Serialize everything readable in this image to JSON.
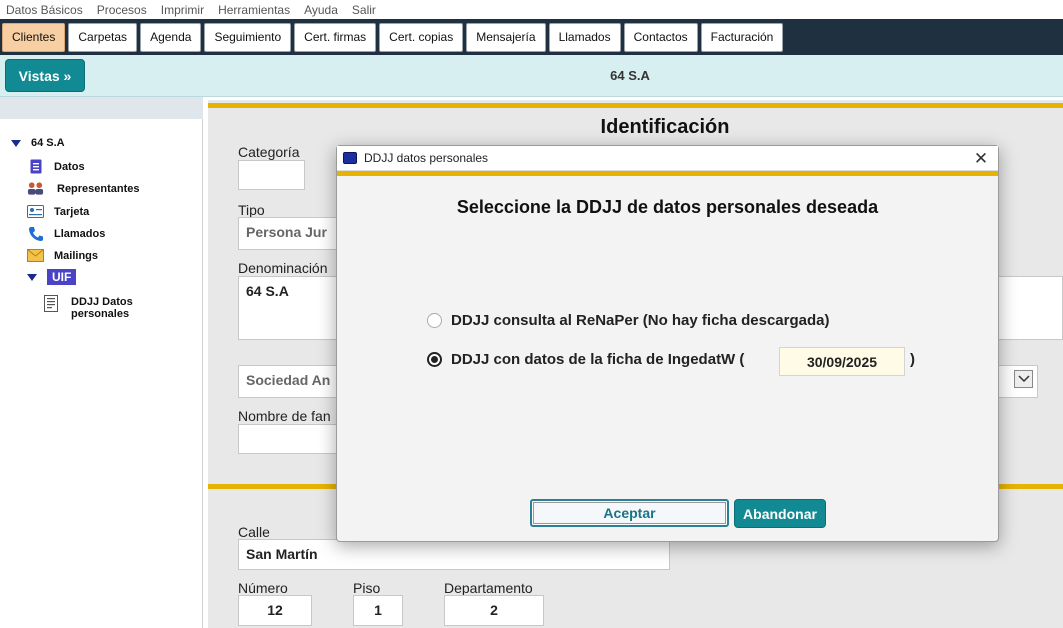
{
  "menu": [
    "Datos Básicos",
    "Procesos",
    "Imprimir",
    "Herramientas",
    "Ayuda",
    "Salir"
  ],
  "tabs": [
    {
      "label": "Clientes",
      "active": true
    },
    {
      "label": "Carpetas",
      "active": false
    },
    {
      "label": "Agenda",
      "active": false
    },
    {
      "label": "Seguimiento",
      "active": false
    },
    {
      "label": "Cert. firmas",
      "active": false
    },
    {
      "label": "Cert. copias",
      "active": false
    },
    {
      "label": "Mensajería",
      "active": false
    },
    {
      "label": "Llamados",
      "active": false
    },
    {
      "label": "Contactos",
      "active": false
    },
    {
      "label": "Facturación",
      "active": false
    }
  ],
  "header": {
    "vistas_label": "Vistas »",
    "title": "64 S.A"
  },
  "sidebar": {
    "root": "64 S.A",
    "items": [
      "Datos",
      "Representantes",
      "Tarjeta",
      "Llamados",
      "Mailings"
    ],
    "uif": "UIF",
    "uif_child_line1": "DDJJ Datos",
    "uif_child_line2": "personales"
  },
  "form": {
    "section_title": "Identificación",
    "categoria_label": "Categoría",
    "categoria_value": "",
    "tipo_label": "Tipo",
    "tipo_value": "Persona Jur",
    "denominacion_label": "Denominación",
    "denominacion_value": "64 S.A",
    "sociedad_value": "Sociedad An",
    "nombre_fantasia_label": "Nombre de fan",
    "nombre_fantasia_value": "",
    "calle_label": "Calle",
    "calle_value": "San Martín",
    "numero_label": "Número",
    "numero_value": "12",
    "piso_label": "Piso",
    "piso_value": "1",
    "departamento_label": "Departamento",
    "departamento_value": "2"
  },
  "dialog": {
    "title": "DDJJ datos personales",
    "heading": "Seleccione la DDJJ de datos personales deseada",
    "option1": "DDJJ consulta al ReNaPer (No hay ficha descargada)",
    "option2": "DDJJ con datos de la ficha de IngedatW (",
    "option2_date": "30/09/2025",
    "option2_suffix": ")",
    "selected_option": 2,
    "accept_label": "Aceptar",
    "cancel_label": "Abandonar"
  },
  "colors": {
    "accent": "#128a93",
    "gold": "#e6b400",
    "tab_active": "#f8cfa3",
    "toolbar": "#1f3040",
    "header_bg": "#d8eff2"
  }
}
